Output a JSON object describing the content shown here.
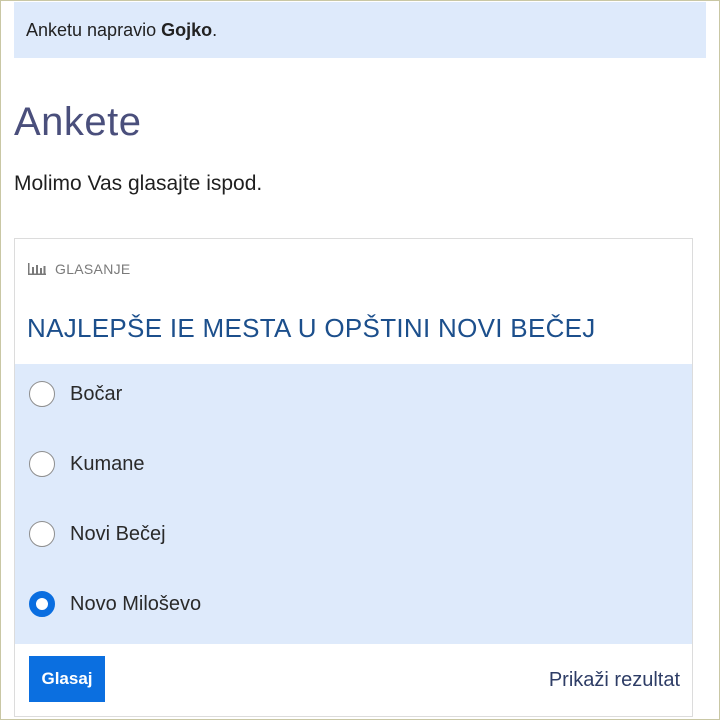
{
  "notice": {
    "prefix": "Anketu napravio ",
    "author": "Gojko",
    "suffix": "."
  },
  "page": {
    "title": "Ankete",
    "subtitle": "Molimo Vas glasajte ispod."
  },
  "poll": {
    "header_icon": "bar-chart-icon",
    "header_label": "GLASANJE",
    "question": "NAJLEPŠE IE MESTA U OPŠTINI NOVI BEČEJ",
    "options": [
      {
        "label": "Bočar",
        "selected": false
      },
      {
        "label": "Kumane",
        "selected": false
      },
      {
        "label": "Novi Bečej",
        "selected": false
      },
      {
        "label": "Novo Miloševo",
        "selected": true
      }
    ],
    "vote_label": "Glasaj",
    "results_label": "Prikaži rezultat"
  },
  "colors": {
    "accent": "#0b6fe0",
    "notice_bg": "#deeafb",
    "question": "#1c4f8c",
    "title": "#4a4f7c"
  }
}
